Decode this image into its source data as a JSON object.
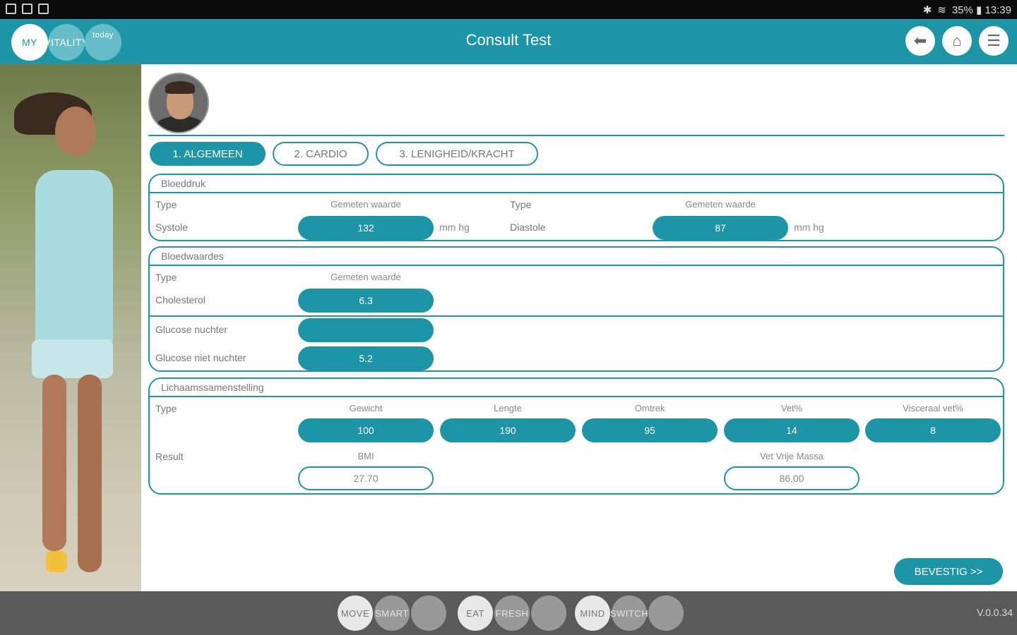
{
  "status": {
    "right_text": "35% ▮ 13:39"
  },
  "header": {
    "title": "Consult Test",
    "logo": [
      "MY",
      "VITALITY",
      "today"
    ]
  },
  "tabs": [
    {
      "label": "1. ALGEMEEN",
      "active": true
    },
    {
      "label": "2. CARDIO",
      "active": false
    },
    {
      "label": "3. LENIGHEID/KRACHT",
      "active": false
    }
  ],
  "bloeddruk": {
    "title": "Bloeddruk",
    "type_label": "Type",
    "measured_label": "Gemeten waarde",
    "type_label2": "Type",
    "measured_label2": "Gemeten waarde",
    "systole": {
      "label": "Systole",
      "value": "132",
      "unit": "mm hg"
    },
    "diastole": {
      "label": "Diastole",
      "value": "87",
      "unit": "mm hg"
    }
  },
  "bloedwaardes": {
    "title": "Bloedwaardes",
    "type_label": "Type",
    "measured_label": "Gemeten waarde",
    "cholesterol": {
      "label": "Cholesterol",
      "value": "6.3"
    },
    "glucose_nuchter": {
      "label": "Glucose nuchter",
      "value": ""
    },
    "glucose_niet_nuchter": {
      "label": "Glucose niet nuchter",
      "value": "5.2"
    }
  },
  "lichaam": {
    "title": "Lichaamssamenstelling",
    "type_label": "Type",
    "result_label": "Result",
    "headers": [
      "Gewicht",
      "Lengte",
      "Omtrek",
      "Vet%",
      "Visceraal vet%"
    ],
    "values": [
      "100",
      "190",
      "95",
      "14",
      "8"
    ],
    "bmi_label": "BMI",
    "bmi_value": "27.70",
    "vvm_label": "Vet Vrije Massa",
    "vvm_value": "86.00"
  },
  "confirm_label": "BEVESTIG >>",
  "footer": {
    "groups": [
      [
        "MOVE",
        "SMART",
        ""
      ],
      [
        "EAT",
        "FRESH",
        ""
      ],
      [
        "MIND",
        "SWITCH",
        ""
      ]
    ],
    "version": "V.0.0.34"
  }
}
